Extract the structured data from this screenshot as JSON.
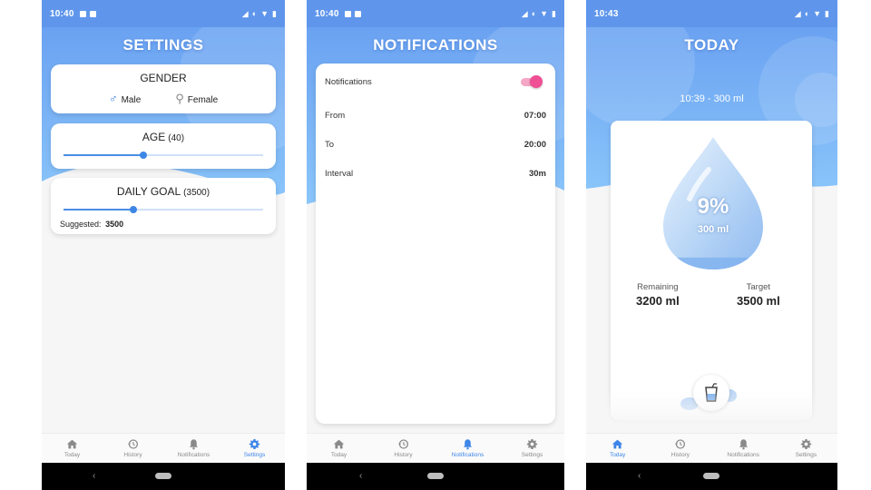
{
  "status_bars": [
    {
      "time": "10:40"
    },
    {
      "time": "10:40"
    },
    {
      "time": "10:43"
    }
  ],
  "settings": {
    "title": "SETTINGS",
    "gender": {
      "title": "GENDER",
      "male": "Male",
      "female": "Female",
      "male_icon": "male-symbol-icon",
      "female_icon": "female-symbol-icon"
    },
    "age": {
      "title": "AGE",
      "value": "(40)",
      "slider_fraction": 0.4
    },
    "daily_goal": {
      "title": "DAILY GOAL",
      "value": "(3500)",
      "slider_fraction": 0.35,
      "suggested_label": "Suggested:",
      "suggested_value": "3500"
    }
  },
  "notifications": {
    "title": "NOTIFICATIONS",
    "toggle_label": "Notifications",
    "toggle_on": true,
    "rows": [
      {
        "label": "From",
        "value": "07:00"
      },
      {
        "label": "To",
        "value": "20:00"
      },
      {
        "label": "Interval",
        "value": "30m"
      }
    ]
  },
  "today": {
    "title": "TODAY",
    "last_entry": "10:39 - 300 ml",
    "percent": "9%",
    "consumed": "300 ml",
    "fill_fraction": 0.09,
    "remaining_label": "Remaining",
    "remaining_value": "3200 ml",
    "target_label": "Target",
    "target_value": "3500 ml"
  },
  "nav": {
    "tabs": [
      {
        "label": "Today",
        "icon": "home-icon"
      },
      {
        "label": "History",
        "icon": "history-icon"
      },
      {
        "label": "Notifications",
        "icon": "bell-icon"
      },
      {
        "label": "Settings",
        "icon": "gear-icon"
      }
    ]
  },
  "colors": {
    "primary": "#3d85e8",
    "accent_pink": "#ef4f95",
    "header_blue": "#6aa2f2"
  }
}
